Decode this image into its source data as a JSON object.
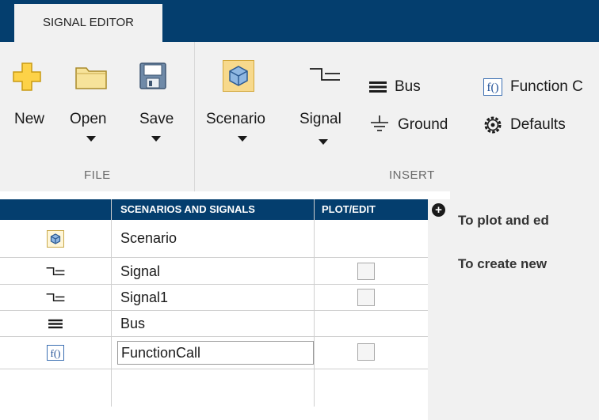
{
  "tabs": {
    "active": "SIGNAL EDITOR"
  },
  "file_section": {
    "label": "FILE",
    "new_label": "New",
    "open_label": "Open",
    "save_label": "Save"
  },
  "insert_section": {
    "label": "INSERT",
    "scenario_label": "Scenario",
    "signal_label": "Signal",
    "bus_label": "Bus",
    "ground_label": "Ground",
    "function_label": "Function C",
    "defaults_label": "Defaults"
  },
  "table": {
    "col_signals": "SCENARIOS AND SIGNALS",
    "col_plot": "PLOT/EDIT",
    "rows": [
      {
        "icon": "scenario-icon",
        "name": "Scenario"
      },
      {
        "icon": "signal-icon",
        "name": "Signal"
      },
      {
        "icon": "signal-icon",
        "name": "Signal1"
      },
      {
        "icon": "bus-icon",
        "name": "Bus"
      },
      {
        "icon": "function-call-icon",
        "name": "FunctionCall"
      }
    ]
  },
  "right_panel": {
    "line1": "To plot and ed",
    "line2": "To create new"
  }
}
